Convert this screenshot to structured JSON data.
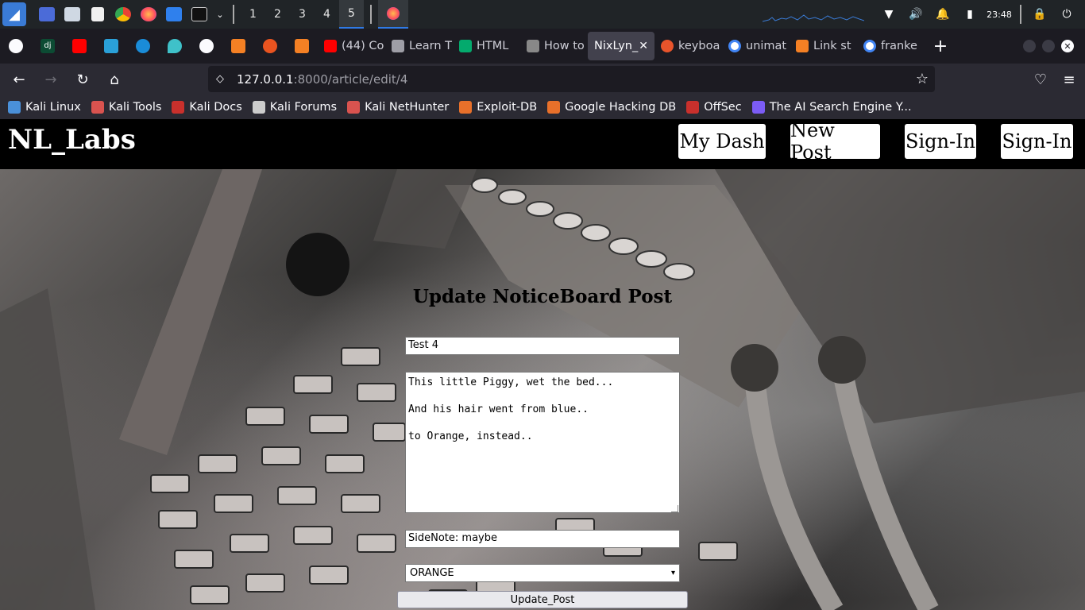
{
  "taskbar": {
    "workspaces": [
      "1",
      "2",
      "3",
      "4",
      "5"
    ],
    "active_workspace": "5",
    "clock": "23:48"
  },
  "browser": {
    "tabs": [
      {
        "label": "(44) Co",
        "color": "#ff0000"
      },
      {
        "label": "Learn T",
        "color": "#9e9ea6"
      },
      {
        "label": "HTML",
        "color": "#04aa6d"
      },
      {
        "label": "How to",
        "color": "#888888"
      },
      {
        "label": "NixLyn_",
        "color": "#42414d",
        "active": true
      },
      {
        "label": "keyboa",
        "color": "#e8542b"
      },
      {
        "label": "unimat",
        "color": "#4285f4"
      },
      {
        "label": "Link st",
        "color": "#f48024"
      },
      {
        "label": "franke",
        "color": "#4285f4"
      }
    ],
    "url_host": "127.0.0.1",
    "url_rest": ":8000/article/edit/4",
    "bookmarks": [
      {
        "label": "Kali Linux",
        "color": "#4a90d9"
      },
      {
        "label": "Kali Tools",
        "color": "#d9534f"
      },
      {
        "label": "Kali Docs",
        "color": "#c9302c"
      },
      {
        "label": "Kali Forums",
        "color": "#cccccc"
      },
      {
        "label": "Kali NetHunter",
        "color": "#d9534f"
      },
      {
        "label": "Exploit-DB",
        "color": "#e8702a"
      },
      {
        "label": "Google Hacking DB",
        "color": "#e8702a"
      },
      {
        "label": "OffSec",
        "color": "#c9302c"
      },
      {
        "label": "The AI Search Engine Y...",
        "color": "#7b5cf5"
      }
    ]
  },
  "site": {
    "brand": "NL_Labs",
    "nav": [
      "My Dash",
      "New Post",
      "Sign-In",
      "Sign-In"
    ]
  },
  "form": {
    "heading": "Update NoticeBoard Post",
    "title_value": "Test 4",
    "body_value": "This little Piggy, wet the bed...\n\nAnd his hair went from blue..\n\nto Orange, instead..",
    "sidenote_value": "SideNote: maybe",
    "color_selected": "ORANGE",
    "submit_label": "Update_Post"
  }
}
